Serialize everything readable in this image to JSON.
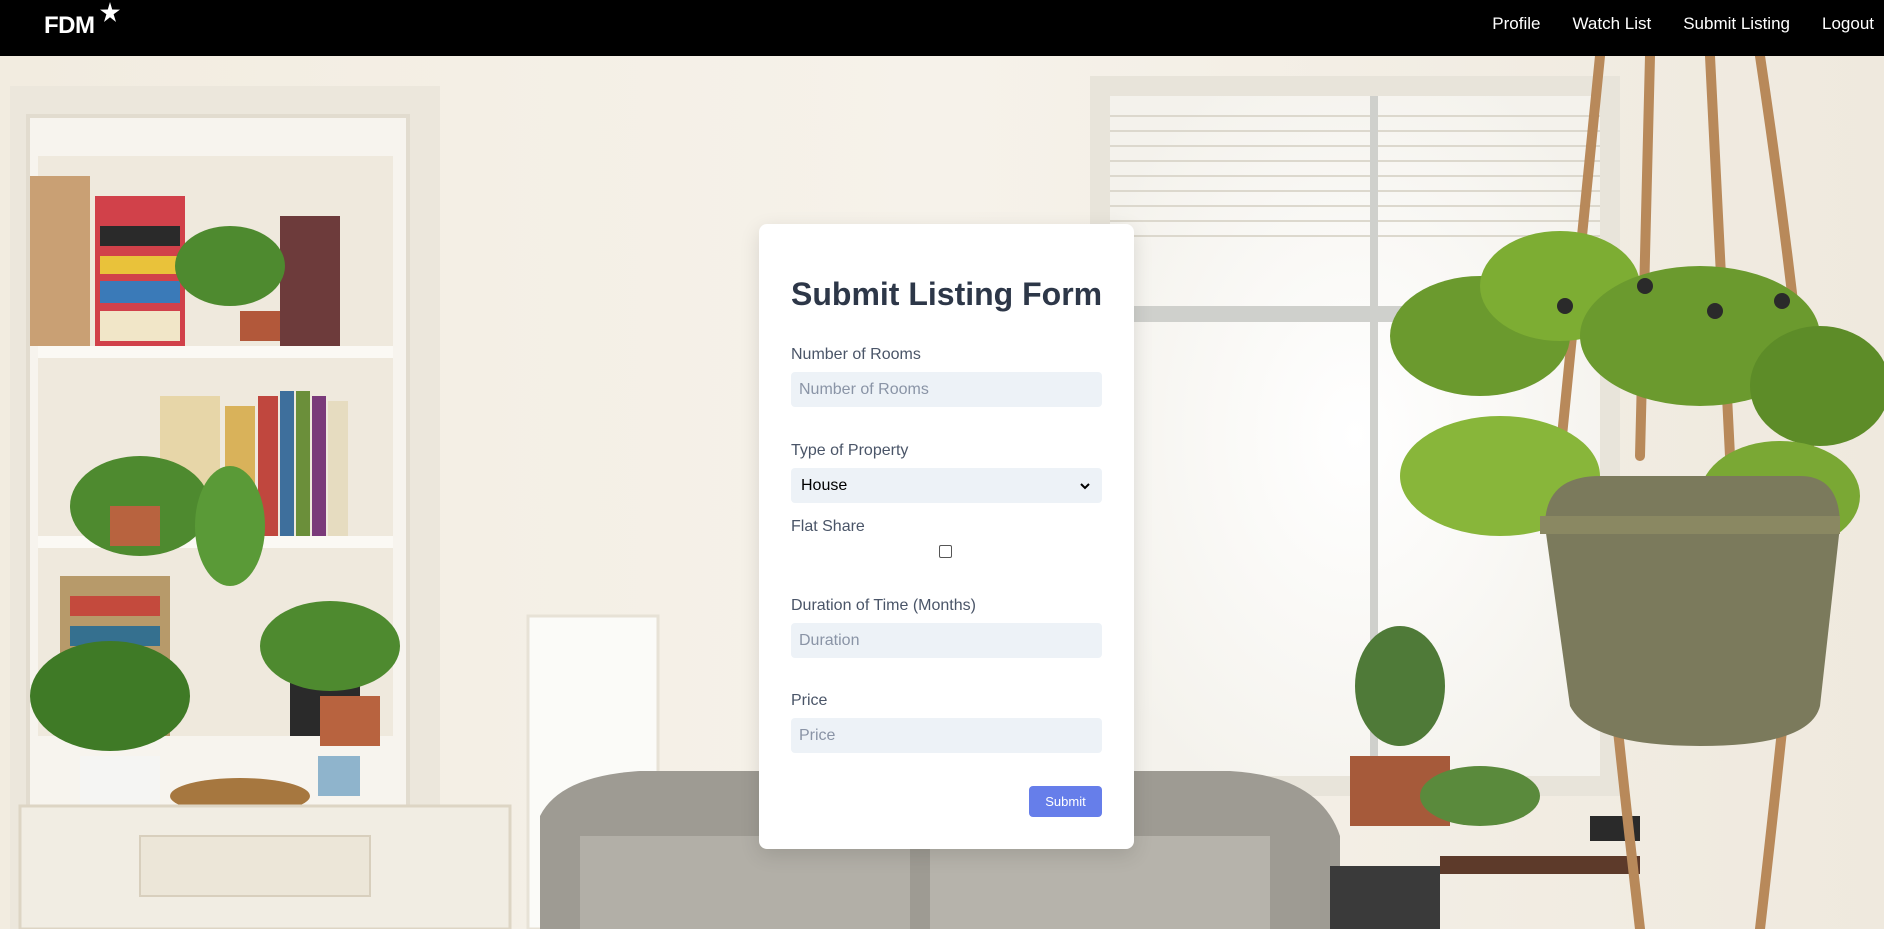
{
  "header": {
    "logo": "FDM",
    "nav": [
      "Profile",
      "Watch List",
      "Submit Listing",
      "Logout"
    ]
  },
  "form": {
    "title": "Submit Listing Form",
    "rooms_label": "Number of Rooms",
    "rooms_placeholder": "Number of Rooms",
    "type_label": "Type of Property",
    "type_selected": "House",
    "flatshare_label": "Flat Share",
    "duration_label": "Duration of Time (Months)",
    "duration_placeholder": "Duration",
    "price_label": "Price",
    "price_placeholder": "Price",
    "submit_label": "Submit"
  },
  "colors": {
    "header_bg": "#000000",
    "button": "#667eea",
    "title": "#2d3748"
  }
}
